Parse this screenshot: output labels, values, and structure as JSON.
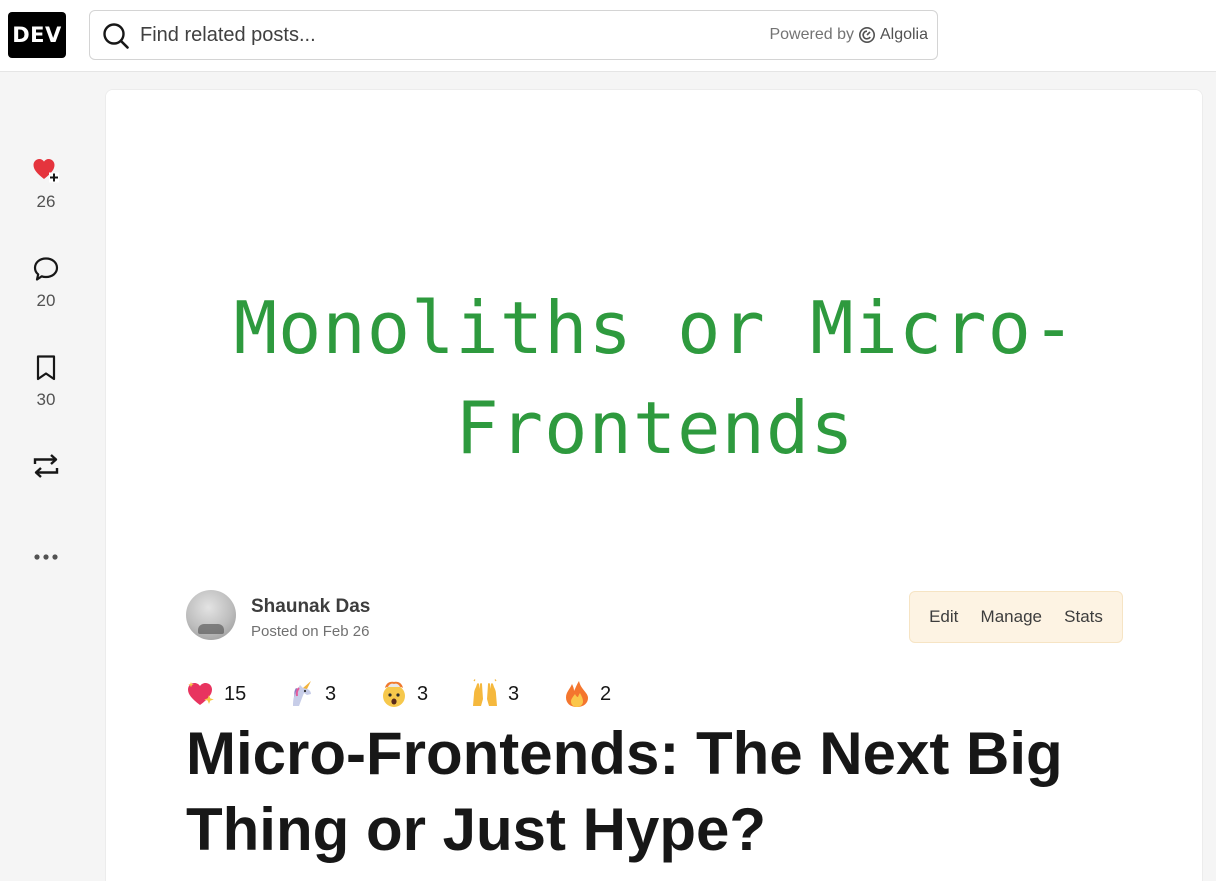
{
  "header": {
    "logo": "DEV",
    "search_placeholder": "Find related posts...",
    "powered_by": "Powered by",
    "powered_brand": "Algolia"
  },
  "rail": {
    "likes": "26",
    "comments": "20",
    "bookmarks": "30"
  },
  "article": {
    "cover_line1": "Monoliths or Micro-",
    "cover_line2": "Frontends",
    "author_name": "Shaunak Das",
    "posted": "Posted on Feb 26",
    "actions": {
      "edit": "Edit",
      "manage": "Manage",
      "stats": "Stats"
    },
    "reactions": [
      {
        "icon": "sparkle-heart-icon",
        "count": "15"
      },
      {
        "icon": "unicorn-icon",
        "count": "3"
      },
      {
        "icon": "exploding-head-icon",
        "count": "3"
      },
      {
        "icon": "raised-hands-icon",
        "count": "3"
      },
      {
        "icon": "fire-icon",
        "count": "2"
      }
    ],
    "title": "Micro-Frontends: The Next Big Thing or Just Hype?"
  },
  "colors": {
    "accent_green": "#2e9a3e",
    "heart_red": "#e5343d",
    "actions_bg": "#fdf3e3"
  }
}
